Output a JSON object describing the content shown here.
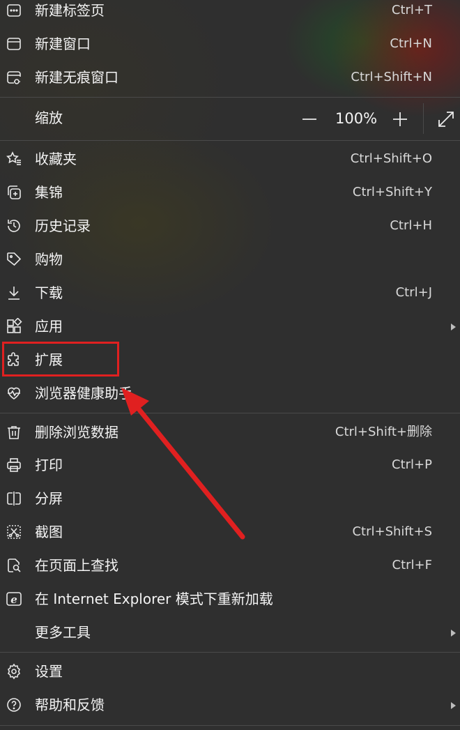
{
  "menu": {
    "new_tab": {
      "label": "新建标签页",
      "shortcut": "Ctrl+T"
    },
    "new_window": {
      "label": "新建窗口",
      "shortcut": "Ctrl+N"
    },
    "new_inprivate": {
      "label": "新建无痕窗口",
      "shortcut": "Ctrl+Shift+N"
    },
    "zoom": {
      "label": "缩放",
      "minus": "—",
      "value": "100%",
      "plus": "+"
    },
    "favorites": {
      "label": "收藏夹",
      "shortcut": "Ctrl+Shift+O"
    },
    "collections": {
      "label": "集锦",
      "shortcut": "Ctrl+Shift+Y"
    },
    "history": {
      "label": "历史记录",
      "shortcut": "Ctrl+H"
    },
    "shopping": {
      "label": "购物"
    },
    "downloads": {
      "label": "下载",
      "shortcut": "Ctrl+J"
    },
    "apps": {
      "label": "应用"
    },
    "extensions": {
      "label": "扩展"
    },
    "browser_health": {
      "label": "浏览器健康助手"
    },
    "clear_data": {
      "label": "删除浏览数据",
      "shortcut": "Ctrl+Shift+删除"
    },
    "print": {
      "label": "打印",
      "shortcut": "Ctrl+P"
    },
    "split_screen": {
      "label": "分屏"
    },
    "screenshot": {
      "label": "截图",
      "shortcut": "Ctrl+Shift+S"
    },
    "find": {
      "label": "在页面上查找",
      "shortcut": "Ctrl+F"
    },
    "ie_mode": {
      "label": "在 Internet Explorer 模式下重新加载"
    },
    "more_tools": {
      "label": "更多工具"
    },
    "settings": {
      "label": "设置"
    },
    "help": {
      "label": "帮助和反馈"
    }
  },
  "annotation": {
    "color": "#e02020"
  }
}
